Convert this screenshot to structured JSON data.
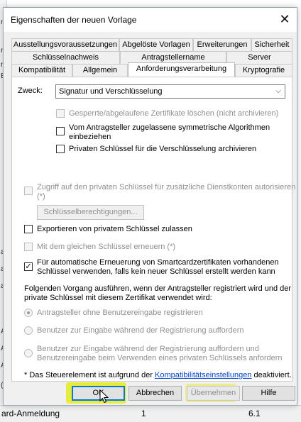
{
  "dialog": {
    "title": "Eigenschaften der neuen Vorlage"
  },
  "tabs": {
    "row1": [
      "Ausstellungsvoraussetzungen",
      "Abgelöste Vorlagen",
      "Erweiterungen",
      "Sicherheit"
    ],
    "row2": [
      "Schlüsselnachweis",
      "Antragstellername",
      "Server"
    ],
    "row3": [
      "Kompatibilität",
      "Allgemein",
      "Anforderungsverarbeitung",
      "Kryptografie"
    ]
  },
  "form": {
    "purpose_label": "Zweck:",
    "purpose_value": "Signatur und Verschlüsselung",
    "cb_delete_revoked": "Gesperrte/abgelaufene Zertifikate löschen (nicht archivieren)",
    "cb_symmetric_line1": "Vom Antragsteller zugelassene symmetrische Algorithmen",
    "cb_symmetric_line2": "einbeziehen",
    "cb_archive": "Privaten Schlüssel für die Verschlüsselung archivieren",
    "cb_service_access_line1": "Zugriff auf den privaten Schlüssel für zusätzliche Dienstkonten autorisieren",
    "cb_service_access_line2": "(*)",
    "key_permissions_button": "Schlüsselberechtigungen...",
    "cb_export": "Exportieren von privatem Schlüssel zulassen",
    "cb_renew_same_key": "Mit dem gleichen Schlüssel erneuern (*)",
    "cb_smartcard_line1": "Für automatische Erneuerung von Smartcardzertifikaten vorhandenen",
    "cb_smartcard_line2": "Schlüssel verwenden, falls kein neuer Schlüssel erstellt werden kann",
    "process_line1": "Folgenden Vorgang ausführen, wenn der Antragsteller registriert wird und der",
    "process_line2": "private Schlüssel mit diesem Zertifikat verwendet wird:",
    "radio_no_input": "Antragsteller ohne Benutzereingabe registrieren",
    "radio_prompt_enroll": "Benutzer zur Eingabe während der Registrierung auffordern",
    "radio_prompt_both_line1": "Benutzer zur Eingabe während der Registrierung auffordern und",
    "radio_prompt_both_line2": "Benutzereingabe beim Verwenden eines privaten Schlüssels anfordern",
    "footnote_prefix": "* Das Steuerelement ist aufgrund der",
    "footnote_link": "Kompatibilitätseinstellungen",
    "footnote_suffix": "deaktiviert."
  },
  "buttons": {
    "ok": "OK",
    "cancel": "Abbrechen",
    "apply": "Übernehmen",
    "help": "Hilfe"
  },
  "background": {
    "row_name": "ard-Anmeldung",
    "row_col2": "1",
    "row_col3": "6.1",
    "left_edge_letters": [
      "n",
      "n",
      "n",
      "E",
      "a",
      "a",
      "a",
      "A",
      "A",
      "A",
      "("
    ]
  },
  "icons": {
    "close": "close-icon",
    "dropdown": "chevron-down-icon",
    "cursor": "mouse-pointer-icon"
  },
  "colors": {
    "accent": "#0078d7",
    "link": "#0044cc",
    "highlight": "#e6eb00",
    "dialog_bg": "#f0f0f0"
  },
  "state": {
    "active_tab": "Anforderungsverarbeitung",
    "cb_smartcard_checked": true
  }
}
